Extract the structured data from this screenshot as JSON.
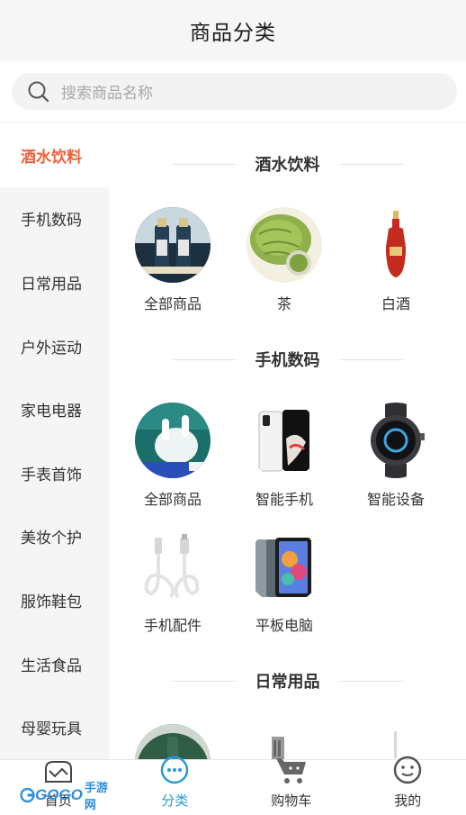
{
  "header": {
    "title": "商品分类"
  },
  "search": {
    "placeholder": "搜索商品名称",
    "icon": "search-icon"
  },
  "sidebar": {
    "items": [
      {
        "label": "酒水饮料",
        "active": true
      },
      {
        "label": "手机数码",
        "active": false
      },
      {
        "label": "日常用品",
        "active": false
      },
      {
        "label": "户外运动",
        "active": false
      },
      {
        "label": "家电电器",
        "active": false
      },
      {
        "label": "手表首饰",
        "active": false
      },
      {
        "label": "美妆个护",
        "active": false
      },
      {
        "label": "服饰鞋包",
        "active": false
      },
      {
        "label": "生活食品",
        "active": false
      },
      {
        "label": "母婴玩具",
        "active": false
      }
    ]
  },
  "sections": [
    {
      "title": "酒水饮料",
      "items": [
        {
          "label": "全部商品"
        },
        {
          "label": "茶"
        },
        {
          "label": "白酒"
        }
      ]
    },
    {
      "title": "手机数码",
      "items": [
        {
          "label": "全部商品"
        },
        {
          "label": "智能手机"
        },
        {
          "label": "智能设备"
        },
        {
          "label": "手机配件"
        },
        {
          "label": "平板电脑"
        }
      ]
    },
    {
      "title": "日常用品",
      "items": []
    }
  ],
  "tabbar": {
    "tabs": [
      {
        "label": "首页",
        "icon": "home-icon",
        "active": false
      },
      {
        "label": "分类",
        "icon": "category-icon",
        "active": true
      },
      {
        "label": "购物车",
        "icon": "cart-icon",
        "active": false
      },
      {
        "label": "我的",
        "icon": "profile-icon",
        "active": false
      }
    ]
  },
  "watermark": {
    "text": "GOGO",
    "text2": "手游网"
  },
  "colors": {
    "accent": "#f0603a",
    "tab_active": "#2a9ad8",
    "sidebar_bg": "#f5f5f5",
    "header_bg": "#f6f6f6"
  }
}
